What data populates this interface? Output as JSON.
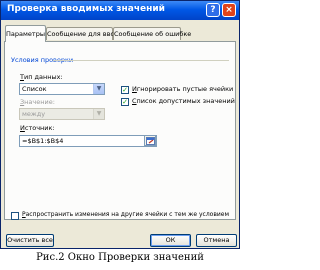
{
  "dialog": {
    "title": "Проверка вводимых значений",
    "help_glyph": "?",
    "close_glyph": "×"
  },
  "tabs": [
    {
      "label": "Параметры",
      "active": true
    },
    {
      "label": "Сообщение для ввода",
      "active": false
    },
    {
      "label": "Сообщение об ошибке",
      "active": false
    }
  ],
  "conditions": {
    "group_label": "Условия проверки",
    "data_type": {
      "label_u": "Т",
      "label_rest": "ип данных:",
      "value": "Список",
      "arrow": "▼"
    },
    "value_field": {
      "label_u": "З",
      "label_rest": "начение:",
      "value": "между",
      "arrow": "▼",
      "disabled": true
    },
    "ignore_blank": {
      "label_u": "И",
      "label_rest": "гнорировать пустые ячейки",
      "checked": true,
      "mark": "✓"
    },
    "in_cell_dropdown": {
      "label_u": "С",
      "label_rest": "писок допустимых значений",
      "checked": true,
      "mark": "✓"
    },
    "source": {
      "label_u": "И",
      "label_rest": "сточник:",
      "value": "=$В$1:$В$4"
    }
  },
  "apply_all": {
    "label_u": "Р",
    "label_rest": "аспространить изменения на другие ячейки с тем же условием",
    "checked": false
  },
  "buttons": {
    "clear_all": "Очистить все",
    "ok": "ОК",
    "cancel": "Отмена"
  },
  "caption": "Рис.2  Окно Проверки значений",
  "colors": {
    "title_bar": "#0058e6",
    "dialog_bg": "#ece9d8",
    "group_label": "#0046d5",
    "check_mark": "#21a121"
  }
}
